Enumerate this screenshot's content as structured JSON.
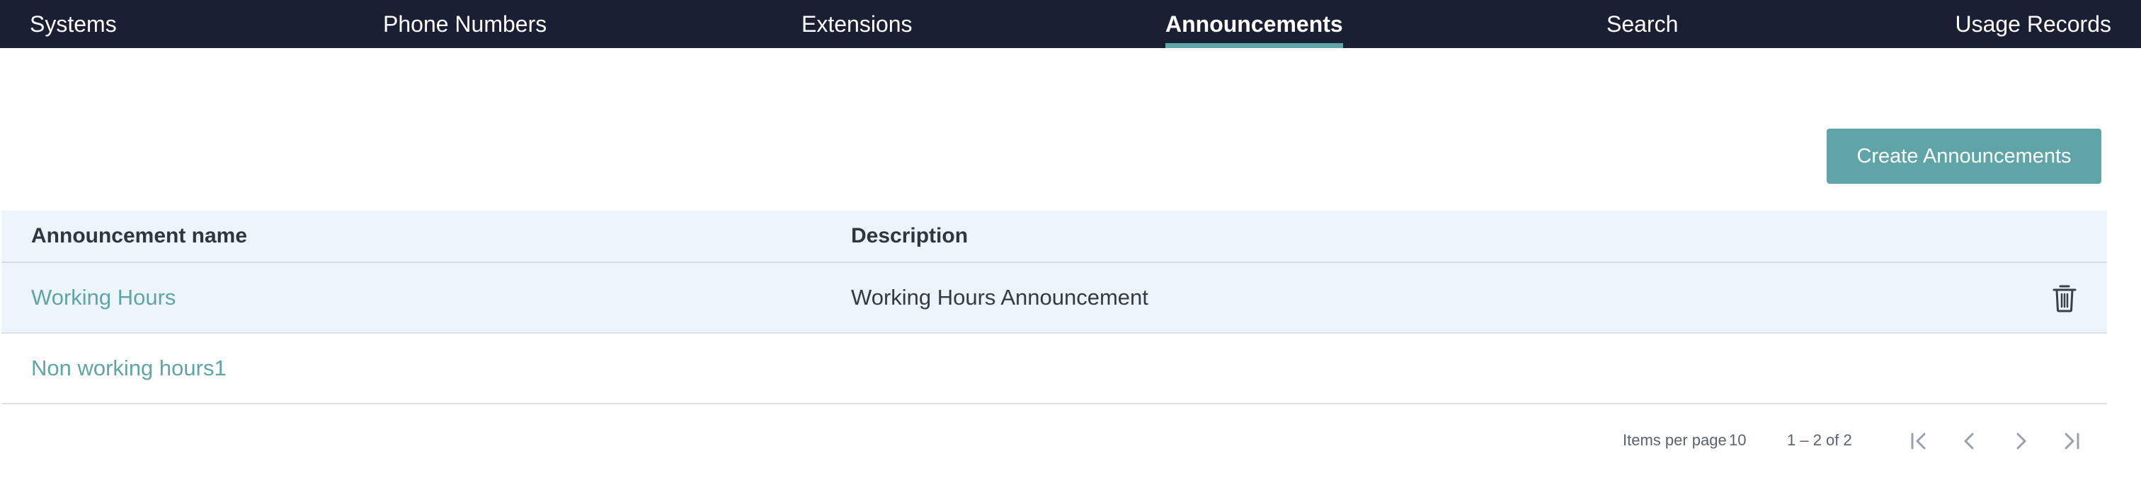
{
  "nav": {
    "items": [
      {
        "label": "Systems"
      },
      {
        "label": "Phone Numbers"
      },
      {
        "label": "Extensions"
      },
      {
        "label": "Announcements",
        "active": true
      },
      {
        "label": "Search"
      },
      {
        "label": "Usage Records"
      }
    ]
  },
  "toolbar": {
    "create_label": "Create Announcements"
  },
  "table": {
    "columns": [
      "Announcement name",
      "Description"
    ],
    "rows": [
      {
        "name": "Working Hours",
        "description": "Working Hours Announcement",
        "icon": "trash-icon"
      },
      {
        "name": "Non working hours1",
        "description": ""
      }
    ]
  },
  "paginator": {
    "items_per_page_label": "Items per page",
    "page_size": "10",
    "range_label": "1 – 2 of 2",
    "icons": [
      "first-page-icon",
      "previous-page-icon",
      "next-page-icon",
      "last-page-icon"
    ]
  },
  "colors": {
    "nav_bg": "#1a1f33",
    "accent": "#5fa5a8",
    "header_bg": "#edf4fa"
  }
}
